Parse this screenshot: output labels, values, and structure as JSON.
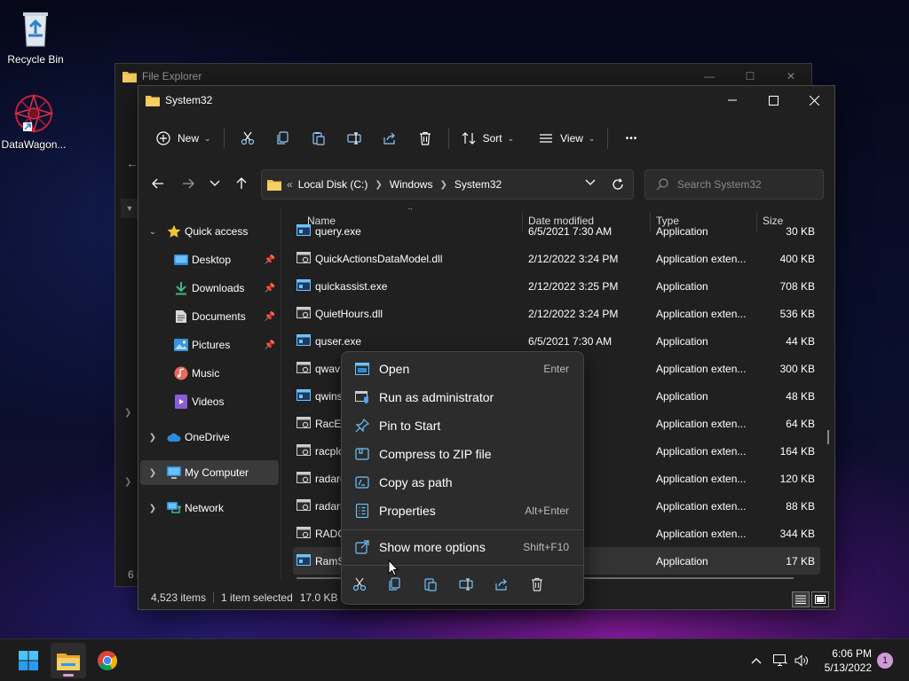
{
  "desktop": {
    "icons": [
      {
        "label": "Recycle Bin"
      },
      {
        "label": "DataWagon..."
      }
    ]
  },
  "background_window": {
    "title": "File Explorer",
    "status": "6 i"
  },
  "window": {
    "title": "System32",
    "command_bar": {
      "new_label": "New",
      "sort_label": "Sort",
      "view_label": "View",
      "more_label": "•••"
    },
    "address": {
      "overflow": "«",
      "segments": [
        "Local Disk (C:)",
        "Windows",
        "System32"
      ]
    },
    "search": {
      "placeholder": "Search System32"
    },
    "nav": {
      "quick_access": "Quick access",
      "pinned": [
        {
          "label": "Desktop"
        },
        {
          "label": "Downloads"
        },
        {
          "label": "Documents"
        },
        {
          "label": "Pictures"
        },
        {
          "label": "Music"
        },
        {
          "label": "Videos"
        }
      ],
      "onedrive": "OneDrive",
      "my_computer": "My Computer",
      "network": "Network"
    },
    "columns": {
      "name": "Name",
      "date": "Date modified",
      "type": "Type",
      "size": "Size"
    },
    "files": [
      {
        "name": "query.exe",
        "date": "6/5/2021 7:30 AM",
        "type": "Application",
        "size": "30 KB"
      },
      {
        "name": "QuickActionsDataModel.dll",
        "date": "2/12/2022 3:24 PM",
        "type": "Application exten...",
        "size": "400 KB"
      },
      {
        "name": "quickassist.exe",
        "date": "2/12/2022 3:25 PM",
        "type": "Application",
        "size": "708 KB"
      },
      {
        "name": "QuietHours.dll",
        "date": "2/12/2022 3:24 PM",
        "type": "Application exten...",
        "size": "536 KB"
      },
      {
        "name": "quser.exe",
        "date": "6/5/2021 7:30 AM",
        "type": "Application",
        "size": "44 KB"
      },
      {
        "name": "qwav",
        "date": "5 AM",
        "type": "Application exten...",
        "size": "300 KB"
      },
      {
        "name": "qwins",
        "date": "0 AM",
        "type": "Application",
        "size": "48 KB"
      },
      {
        "name": "RacEr",
        "date": "6 AM",
        "type": "Application exten...",
        "size": "64 KB"
      },
      {
        "name": "racplo",
        "date": "27 PM",
        "type": "Application exten...",
        "size": "164 KB"
      },
      {
        "name": "radarc",
        "date": "6 AM",
        "type": "Application exten...",
        "size": "120 KB"
      },
      {
        "name": "radarr",
        "date": "6 AM",
        "type": "Application exten...",
        "size": "88 KB"
      },
      {
        "name": "RADC",
        "date": "5 AM",
        "type": "Application exten...",
        "size": "344 KB"
      },
      {
        "name": "RamS",
        "date": "58 PM",
        "type": "Application",
        "size": "17 KB"
      }
    ],
    "status": {
      "items": "4,523 items",
      "selected": "1 item selected",
      "size": "17.0 KB"
    }
  },
  "context_menu": {
    "items": [
      {
        "label": "Open",
        "shortcut": "Enter",
        "icon": "open-icon"
      },
      {
        "label": "Run as administrator",
        "shortcut": "",
        "icon": "shield-icon"
      },
      {
        "label": "Pin to Start",
        "shortcut": "",
        "icon": "pin-icon"
      },
      {
        "label": "Compress to ZIP file",
        "shortcut": "",
        "icon": "zip-icon"
      },
      {
        "label": "Copy as path",
        "shortcut": "",
        "icon": "path-icon"
      },
      {
        "label": "Properties",
        "shortcut": "Alt+Enter",
        "icon": "properties-icon"
      },
      {
        "label": "Show more options",
        "shortcut": "Shift+F10",
        "icon": "more-options-icon"
      }
    ],
    "actions": [
      "cut-icon",
      "copy-icon",
      "paste-icon",
      "rename-icon",
      "share-icon",
      "delete-icon"
    ]
  },
  "taskbar": {
    "time": "6:06 PM",
    "date": "5/13/2022",
    "notification_count": "1"
  },
  "colors": {
    "folder": "#f0c14b",
    "accent_blue": "#4aa3ff",
    "selection": "#333333",
    "notification": "#d09ad8"
  }
}
